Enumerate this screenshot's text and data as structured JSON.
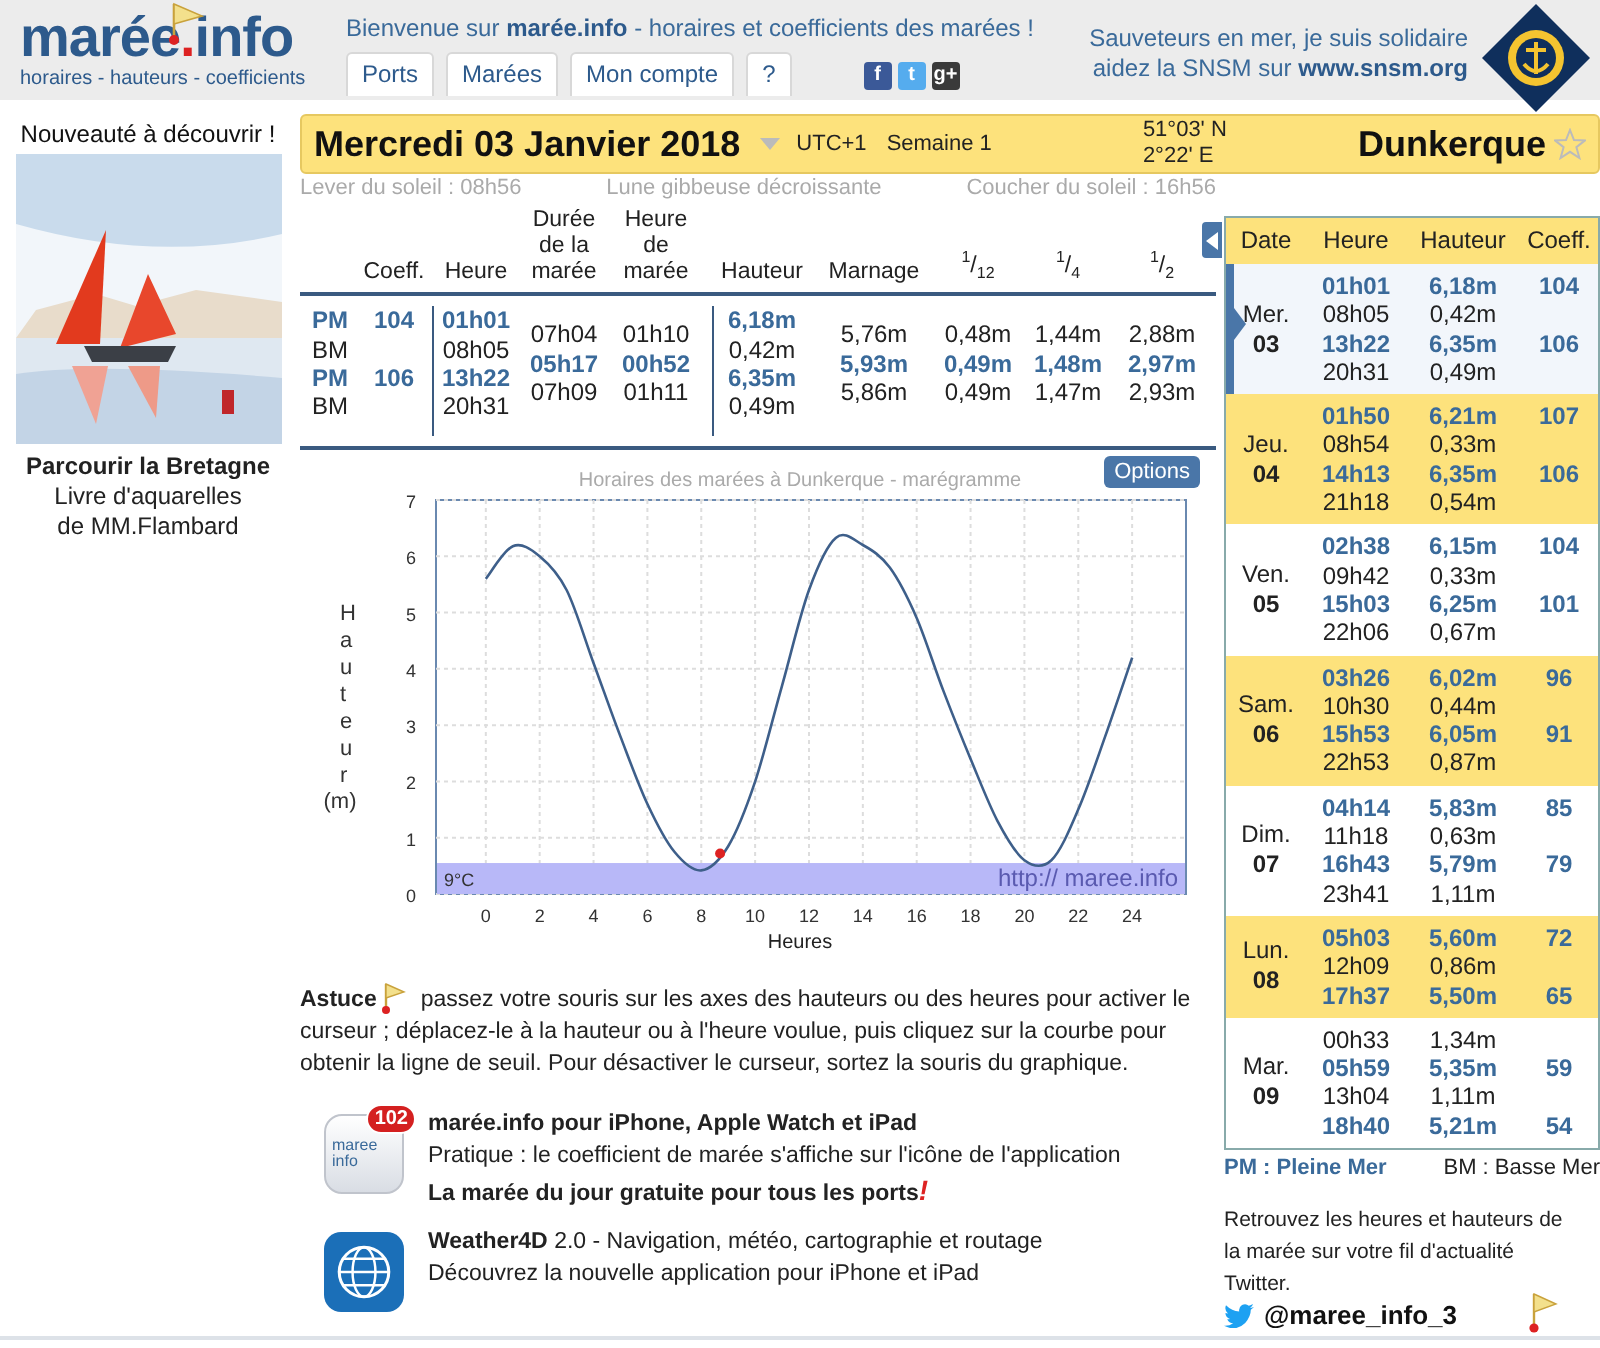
{
  "header": {
    "logo": {
      "name": "marée",
      "dot": ".",
      "suffix": "info",
      "tagline": "horaires - hauteurs - coefficients"
    },
    "welcome": "Bienvenue sur **marée.info** - horaires et coefficients des marées !",
    "tabs": [
      {
        "label": "Ports",
        "selected": false
      },
      {
        "label": "Marées",
        "selected": false
      },
      {
        "label": "Mon compte",
        "selected": false
      },
      {
        "label": "?",
        "selected": false
      }
    ],
    "social": [
      {
        "label": "f",
        "color": "#3b5998"
      },
      {
        "label": "t",
        "color": "#55acee"
      },
      {
        "label": "g+",
        "color": "#3a3a3a"
      }
    ],
    "snsm": {
      "line1": "Sauveteurs en mer, je suis solidaire",
      "line2": "aidez la SNSM sur",
      "link": "www.snsm.org"
    }
  },
  "promo": {
    "title": "Nouveauté à découvrir !",
    "book_title": "Parcourir la Bretagne",
    "book_subtitle": "Livre d'aquarelles de MM.Flambard"
  },
  "date_bar": {
    "date": "Mercredi 03 Janvier 2018",
    "timezone": "UTC+1",
    "week": "Semaine 1",
    "latitude": "51°03' N",
    "longitude": "2°22' E",
    "port": "Dunkerque",
    "favorite": false
  },
  "sun": {
    "sunrise": "Lever du soleil : 08h56",
    "moon": "Lune gibbeuse décroissante",
    "sunset": "Coucher du soleil : 16h56"
  },
  "tide_table": {
    "columns": [
      "Coeff.",
      "Heure",
      "Durée\nde la\nmarée",
      "Heure\nde\nmarée",
      "Hauteur",
      "Marnage",
      "$^{1}$/$_{12}$",
      "$^{1}$/$_{4}$",
      "$^{1}$/$_{2}$"
    ],
    "tides": [
      {
        "type": "PM",
        "high": true,
        "coeff": "104",
        "time": "01h01",
        "height": "6,18m"
      },
      {
        "type": "BM",
        "high": false,
        "time": "08h05",
        "height": "0,42m"
      },
      {
        "type": "PM",
        "high": true,
        "coeff": "106",
        "time": "13h22",
        "height": "6,35m"
      },
      {
        "type": "BM",
        "high": false,
        "time": "20h31",
        "height": "0,49m"
      }
    ],
    "intervals": [
      {
        "duration": "07h04",
        "tide_hour": "01h10",
        "range": "5,76m",
        "twelfth": "0,48m",
        "quarter": "1,44m",
        "half": "2,88m",
        "rising": false
      },
      {
        "duration": "05h17",
        "tide_hour": "00h52",
        "range": "5,93m",
        "twelfth": "0,49m",
        "quarter": "1,48m",
        "half": "2,97m",
        "rising": true
      },
      {
        "duration": "07h09",
        "tide_hour": "01h11",
        "range": "5,86m",
        "twelfth": "0,49m",
        "quarter": "1,47m",
        "half": "2,93m",
        "rising": false
      }
    ]
  },
  "chart": {
    "options_button": "Options",
    "unit": "(m)",
    "band_label": "9°C",
    "credit": "http:// maree.info",
    "chart_data": {
      "type": "line",
      "title": "Horaires des marées à Dunkerque - marégramme",
      "xlabel": "Heures",
      "ylabel": "Hauteur",
      "x": [
        0,
        1,
        2,
        3,
        4,
        5,
        6,
        7,
        8,
        9,
        10,
        11,
        12,
        13,
        14,
        15,
        16,
        17,
        18,
        19,
        20,
        21,
        22,
        23,
        24
      ],
      "series": [
        {
          "color": "#3e5f8a",
          "values": [
            5.6,
            6.18,
            6.0,
            5.4,
            4.1,
            2.8,
            1.6,
            0.75,
            0.42,
            0.85,
            2.0,
            3.7,
            5.4,
            6.33,
            6.2,
            5.8,
            4.9,
            3.6,
            2.4,
            1.3,
            0.6,
            0.6,
            1.5,
            2.8,
            4.2
          ]
        }
      ],
      "xlim": [
        -1.85,
        26
      ],
      "ylim": [
        0,
        7
      ],
      "xticks": [
        0,
        2,
        4,
        6,
        8,
        10,
        12,
        14,
        16,
        18,
        20,
        22,
        24
      ],
      "yticks": [
        0,
        1,
        2,
        3,
        4,
        5,
        6,
        7
      ],
      "grid": true
    }
  },
  "tip": {
    "label": "Astuce",
    "lines": [
      "passez votre souris sur les axes des hauteurs ou des heures pour activer le",
      "curseur ; déplacez-le à la hauteur ou à l'heure voulue, puis cliquez sur la courbe pour",
      "obtenir la ligne de seuil. Pour désactiver le curseur, sortez la souris du graphique."
    ]
  },
  "apps": [
    {
      "kind": "maree",
      "badge": "102",
      "icon_label": "maree\ninfo",
      "title": "marée.info pour iPhone, Apple Watch et iPad",
      "text": "Pratique : le coefficient de marée s'affiche sur l'icône de l'application",
      "promo": "La marée du jour gratuite pour tous les ports",
      "promo_mark": "!"
    },
    {
      "kind": "weather",
      "text": "**Weather4D** 2.0 - Navigation, météo, cartographie et routage",
      "text2": "Découvrez la nouvelle application pour iPhone et iPad"
    }
  ],
  "week": {
    "columns": [
      "Date",
      "Heure",
      "Hauteur",
      "Coeff."
    ],
    "days": [
      {
        "weekday": "Mer.",
        "day": "03",
        "selected": true,
        "tides": [
          {
            "time": "01h01",
            "height": "6,18m",
            "coeff": "104",
            "high": true
          },
          {
            "time": "08h05",
            "height": "0,42m",
            "high": false
          },
          {
            "time": "13h22",
            "height": "6,35m",
            "coeff": "106",
            "high": true
          },
          {
            "time": "20h31",
            "height": "0,49m",
            "high": false
          }
        ]
      },
      {
        "weekday": "Jeu.",
        "day": "04",
        "selected": false,
        "tides": [
          {
            "time": "01h50",
            "height": "6,21m",
            "coeff": "107",
            "high": true
          },
          {
            "time": "08h54",
            "height": "0,33m",
            "high": false
          },
          {
            "time": "14h13",
            "height": "6,35m",
            "coeff": "106",
            "high": true
          },
          {
            "time": "21h18",
            "height": "0,54m",
            "high": false
          }
        ]
      },
      {
        "weekday": "Ven.",
        "day": "05",
        "selected": false,
        "tides": [
          {
            "time": "02h38",
            "height": "6,15m",
            "coeff": "104",
            "high": true
          },
          {
            "time": "09h42",
            "height": "0,33m",
            "high": false
          },
          {
            "time": "15h03",
            "height": "6,25m",
            "coeff": "101",
            "high": true
          },
          {
            "time": "22h06",
            "height": "0,67m",
            "high": false
          }
        ]
      },
      {
        "weekday": "Sam.",
        "day": "06",
        "selected": false,
        "tides": [
          {
            "time": "03h26",
            "height": "6,02m",
            "coeff": "96",
            "high": true
          },
          {
            "time": "10h30",
            "height": "0,44m",
            "high": false
          },
          {
            "time": "15h53",
            "height": "6,05m",
            "coeff": "91",
            "high": true
          },
          {
            "time": "22h53",
            "height": "0,87m",
            "high": false
          }
        ]
      },
      {
        "weekday": "Dim.",
        "day": "07",
        "selected": false,
        "tides": [
          {
            "time": "04h14",
            "height": "5,83m",
            "coeff": "85",
            "high": true
          },
          {
            "time": "11h18",
            "height": "0,63m",
            "high": false
          },
          {
            "time": "16h43",
            "height": "5,79m",
            "coeff": "79",
            "high": true
          },
          {
            "time": "23h41",
            "height": "1,11m",
            "high": false
          }
        ]
      },
      {
        "weekday": "Lun.",
        "day": "08",
        "selected": false,
        "tides": [
          {
            "time": "05h03",
            "height": "5,60m",
            "coeff": "72",
            "high": true
          },
          {
            "time": "12h09",
            "height": "0,86m",
            "high": false
          },
          {
            "time": "17h37",
            "height": "5,50m",
            "coeff": "65",
            "high": true
          }
        ]
      },
      {
        "weekday": "Mar.",
        "day": "09",
        "selected": false,
        "tides": [
          {
            "time": "00h33",
            "height": "1,34m",
            "high": false
          },
          {
            "time": "05h59",
            "height": "5,35m",
            "coeff": "59",
            "high": true
          },
          {
            "time": "13h04",
            "height": "1,11m",
            "high": false
          },
          {
            "time": "18h40",
            "height": "5,21m",
            "coeff": "54",
            "high": true
          }
        ]
      }
    ],
    "legend_high": "PM : Pleine Mer",
    "legend_low": "BM : Basse Mer",
    "twitter": {
      "text": "Retrouvez les heures et hauteurs de la marée sur votre fil d'actualité Twitter.",
      "handle": "@maree_info_3"
    }
  }
}
